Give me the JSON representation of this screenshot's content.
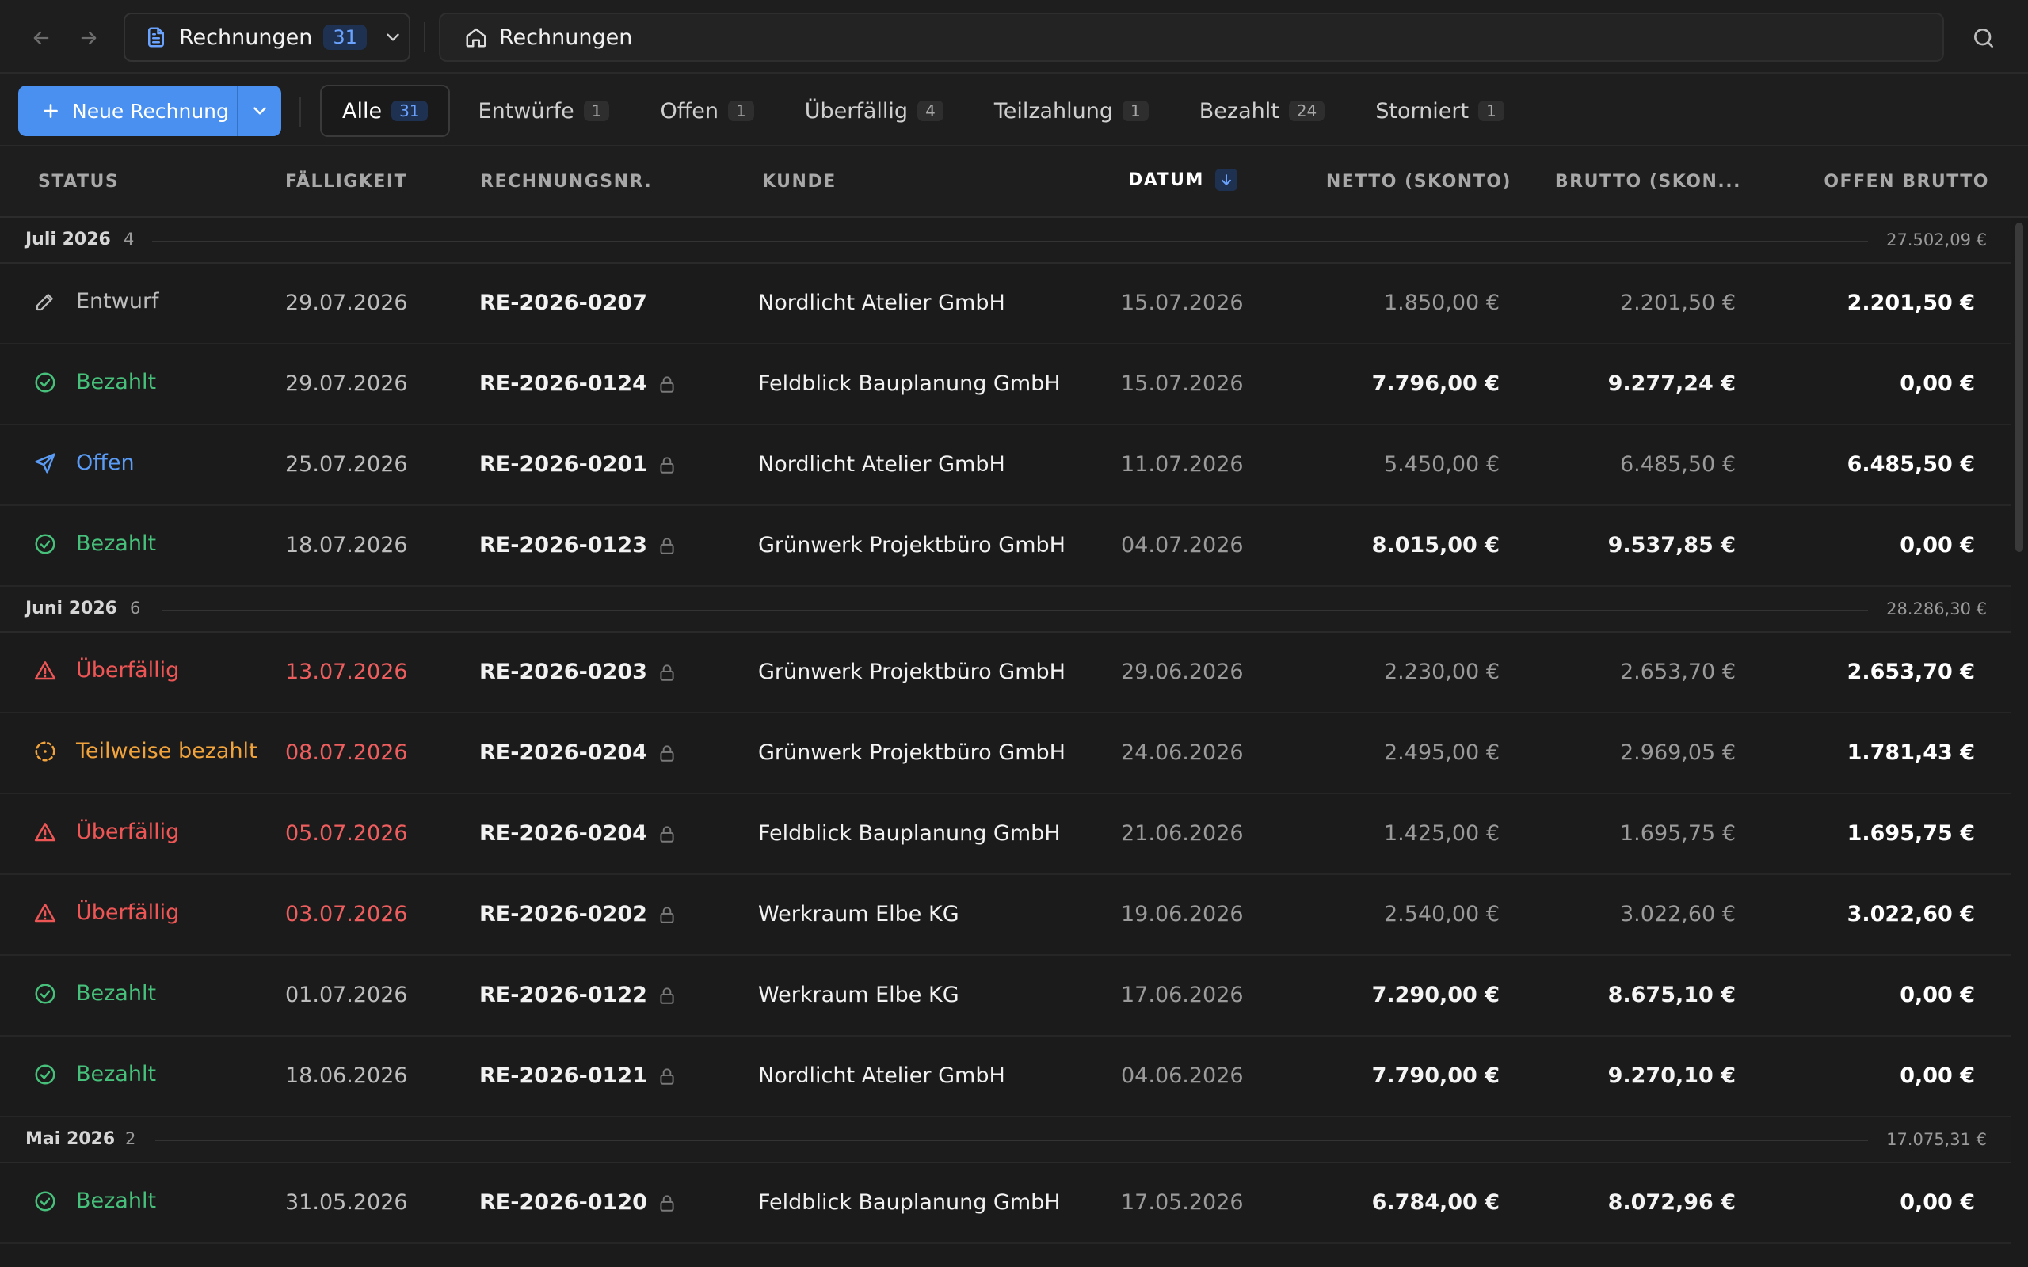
{
  "header": {
    "doc_switcher": {
      "title": "Rechnungen",
      "count": "31"
    },
    "breadcrumb": "Rechnungen"
  },
  "toolbar": {
    "new_button": "Neue Rechnung",
    "tabs": [
      {
        "label": "Alle",
        "count": "31",
        "active": true
      },
      {
        "label": "Entwürfe",
        "count": "1"
      },
      {
        "label": "Offen",
        "count": "1"
      },
      {
        "label": "Überfällig",
        "count": "4"
      },
      {
        "label": "Teilzahlung",
        "count": "1"
      },
      {
        "label": "Bezahlt",
        "count": "24"
      },
      {
        "label": "Storniert",
        "count": "1"
      }
    ]
  },
  "columns": {
    "status": "STATUS",
    "due": "FÄLLIGKEIT",
    "number": "RECHNUNGSNR.",
    "customer": "KUNDE",
    "date": "DATUM",
    "net": "NETTO (SKONTO)",
    "gross": "BRUTTO (SKON...",
    "open": "OFFEN BRUTTO"
  },
  "colors": {
    "accent": "#4a90f0",
    "paid": "#46c07a",
    "open": "#5a9cf5",
    "overdue": "#ee5555",
    "partial": "#f1a33c",
    "background": "#1b1b1b"
  },
  "groups": [
    {
      "name": "Juli 2026",
      "count": "4",
      "sum": "27.502,09 €",
      "rows": [
        {
          "status": "Entwurf",
          "kind": "draft",
          "icon": "pencil-icon",
          "due": "29.07.2026",
          "due_late": false,
          "number": "RE-2026-0207",
          "locked": false,
          "customer": "Nordlicht Atelier GmbH",
          "date": "15.07.2026",
          "net": "1.850,00 €",
          "gross": "2.201,50 €",
          "open": "2.201,50 €",
          "bold_amounts": false
        },
        {
          "status": "Bezahlt",
          "kind": "paid",
          "icon": "check-circle-icon",
          "due": "29.07.2026",
          "due_late": false,
          "number": "RE-2026-0124",
          "locked": true,
          "customer": "Feldblick Bauplanung GmbH",
          "date": "15.07.2026",
          "net": "7.796,00 €",
          "gross": "9.277,24 €",
          "open": "0,00 €",
          "bold_amounts": true
        },
        {
          "status": "Offen",
          "kind": "open",
          "icon": "send-icon",
          "due": "25.07.2026",
          "due_late": false,
          "number": "RE-2026-0201",
          "locked": true,
          "customer": "Nordlicht Atelier GmbH",
          "date": "11.07.2026",
          "net": "5.450,00 €",
          "gross": "6.485,50 €",
          "open": "6.485,50 €",
          "bold_amounts": false
        },
        {
          "status": "Bezahlt",
          "kind": "paid",
          "icon": "check-circle-icon",
          "due": "18.07.2026",
          "due_late": false,
          "number": "RE-2026-0123",
          "locked": true,
          "customer": "Grünwerk Projektbüro GmbH",
          "date": "04.07.2026",
          "net": "8.015,00 €",
          "gross": "9.537,85 €",
          "open": "0,00 €",
          "bold_amounts": true
        }
      ]
    },
    {
      "name": "Juni 2026",
      "count": "6",
      "sum": "28.286,30 €",
      "rows": [
        {
          "status": "Überfällig",
          "kind": "overdue",
          "icon": "warning-triangle-icon",
          "due": "13.07.2026",
          "due_late": true,
          "number": "RE-2026-0203",
          "locked": true,
          "customer": "Grünwerk Projektbüro GmbH",
          "date": "29.06.2026",
          "net": "2.230,00 €",
          "gross": "2.653,70 €",
          "open": "2.653,70 €",
          "bold_amounts": false
        },
        {
          "status": "Teilweise bezahlt",
          "kind": "partial",
          "icon": "partial-circle-icon",
          "due": "08.07.2026",
          "due_late": true,
          "number": "RE-2026-0204",
          "locked": true,
          "customer": "Grünwerk Projektbüro GmbH",
          "date": "24.06.2026",
          "net": "2.495,00 €",
          "gross": "2.969,05 €",
          "open": "1.781,43 €",
          "bold_amounts": false
        },
        {
          "status": "Überfällig",
          "kind": "overdue",
          "icon": "warning-triangle-icon",
          "due": "05.07.2026",
          "due_late": true,
          "number": "RE-2026-0204",
          "locked": true,
          "customer": "Feldblick Bauplanung GmbH",
          "date": "21.06.2026",
          "net": "1.425,00 €",
          "gross": "1.695,75 €",
          "open": "1.695,75 €",
          "bold_amounts": false
        },
        {
          "status": "Überfällig",
          "kind": "overdue",
          "icon": "warning-triangle-icon",
          "due": "03.07.2026",
          "due_late": true,
          "number": "RE-2026-0202",
          "locked": true,
          "customer": "Werkraum Elbe KG",
          "date": "19.06.2026",
          "net": "2.540,00 €",
          "gross": "3.022,60 €",
          "open": "3.022,60 €",
          "bold_amounts": false
        },
        {
          "status": "Bezahlt",
          "kind": "paid",
          "icon": "check-circle-icon",
          "due": "01.07.2026",
          "due_late": false,
          "number": "RE-2026-0122",
          "locked": true,
          "customer": "Werkraum Elbe KG",
          "date": "17.06.2026",
          "net": "7.290,00 €",
          "gross": "8.675,10 €",
          "open": "0,00 €",
          "bold_amounts": true
        },
        {
          "status": "Bezahlt",
          "kind": "paid",
          "icon": "check-circle-icon",
          "due": "18.06.2026",
          "due_late": false,
          "number": "RE-2026-0121",
          "locked": true,
          "customer": "Nordlicht Atelier GmbH",
          "date": "04.06.2026",
          "net": "7.790,00 €",
          "gross": "9.270,10 €",
          "open": "0,00 €",
          "bold_amounts": true
        }
      ]
    },
    {
      "name": "Mai 2026",
      "count": "2",
      "sum": "17.075,31 €",
      "rows": [
        {
          "status": "Bezahlt",
          "kind": "paid",
          "icon": "check-circle-icon",
          "due": "31.05.2026",
          "due_late": false,
          "number": "RE-2026-0120",
          "locked": true,
          "customer": "Feldblick Bauplanung GmbH",
          "date": "17.05.2026",
          "net": "6.784,00 €",
          "gross": "8.072,96 €",
          "open": "0,00 €",
          "bold_amounts": true
        }
      ]
    }
  ]
}
